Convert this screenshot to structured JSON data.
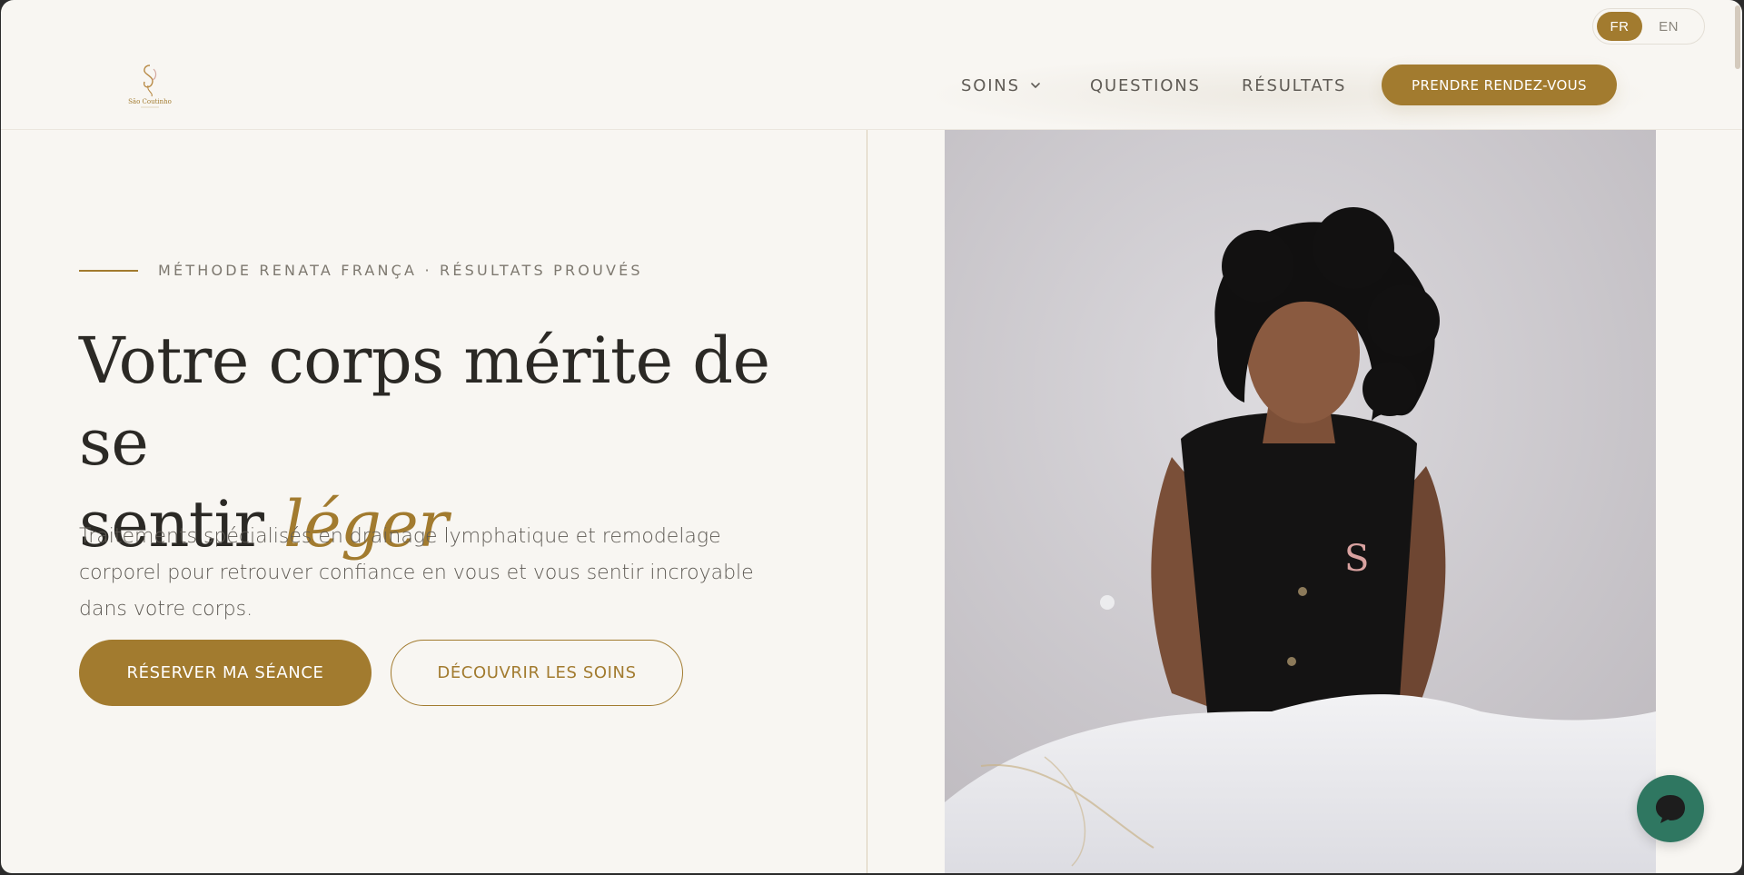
{
  "language": {
    "options": [
      "FR",
      "EN"
    ],
    "active": "FR"
  },
  "header": {
    "logo_text": "Sâo Coutinho",
    "nav": [
      {
        "label": "SOINS",
        "has_dropdown": true
      },
      {
        "label": "QUESTIONS"
      },
      {
        "label": "RÉSULTATS"
      }
    ],
    "cta_label": "PRENDRE RENDEZ-VOUS"
  },
  "hero": {
    "eyebrow": "MÉTHODE RENATA FRANÇA · RÉSULTATS PROUVÉS",
    "headline_line1": "Votre corps mérite de se",
    "headline_line2_prefix": "sentir",
    "headline_accent": "léger",
    "subtitle": "Traitements spécialisés en drainage lymphatique et remodelage corporel pour retrouver confiance en vous et vous sentir incroyable dans votre corps.",
    "primary_button": "RÉSERVER MA SÉANCE",
    "secondary_button": "DÉCOUVRIR LES SOINS"
  },
  "colors": {
    "accent": "#a27b2f",
    "background": "#f8f6f2",
    "text_dark": "#2b2925",
    "chat_green": "#2f7761"
  },
  "icons": [
    "logo-icon",
    "chevron-down-icon",
    "chat-bubble-icon"
  ]
}
